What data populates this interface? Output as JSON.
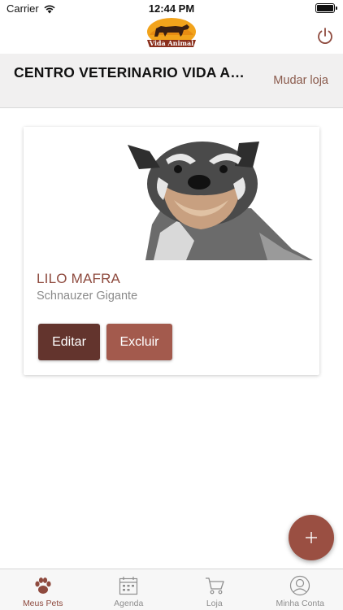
{
  "status_bar": {
    "carrier": "Carrier",
    "time": "12:44 PM"
  },
  "nav": {
    "logo_text": "Vida Animal",
    "logo_icon": "horse-logo",
    "power_icon": "power-icon"
  },
  "store": {
    "name": "CENTRO VETERINARIO VIDA ANI...",
    "change_label": "Mudar loja"
  },
  "pets": [
    {
      "name": "LILO MAFRA",
      "breed": "Schnauzer Gigante",
      "edit_label": "Editar",
      "delete_label": "Excluir"
    }
  ],
  "fab": {
    "icon": "plus-icon"
  },
  "tabs": [
    {
      "label": "Meus Pets",
      "icon": "paw-icon",
      "active": true
    },
    {
      "label": "Agenda",
      "icon": "calendar-icon",
      "active": false
    },
    {
      "label": "Loja",
      "icon": "cart-icon",
      "active": false
    },
    {
      "label": "Minha Conta",
      "icon": "user-icon",
      "active": false
    }
  ],
  "colors": {
    "accent": "#8e4a3e",
    "edit_button": "#63342d",
    "delete_button": "#a35a4d",
    "fab": "#9a4f42"
  }
}
